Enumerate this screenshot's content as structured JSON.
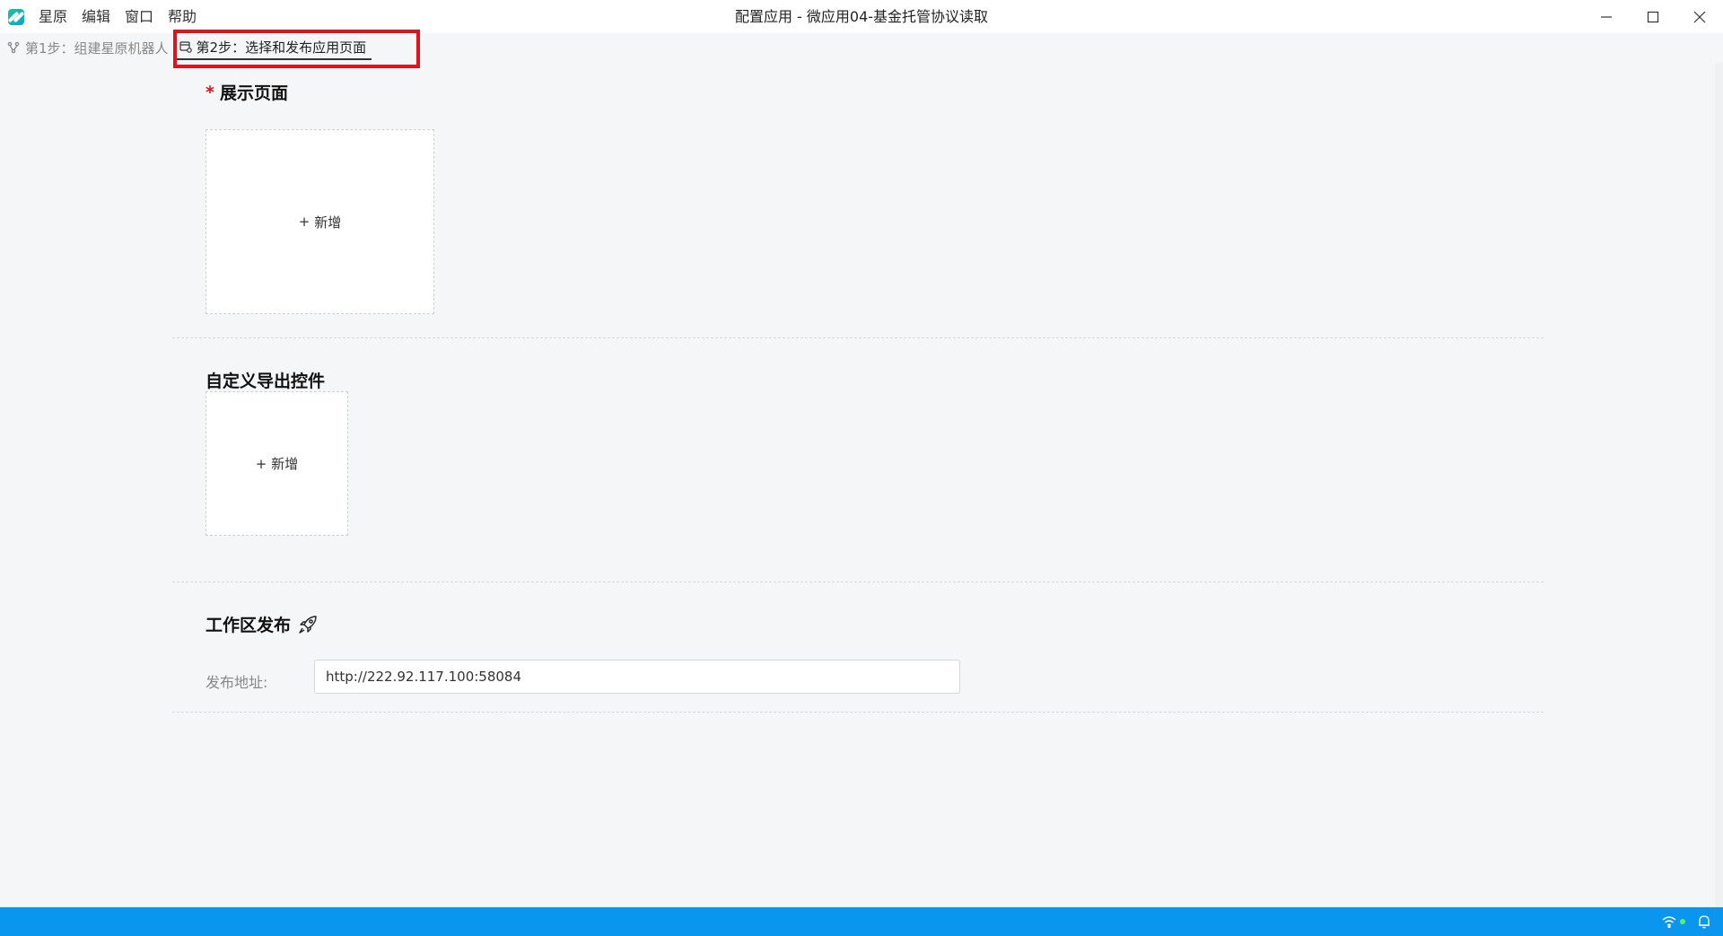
{
  "titlebar": {
    "menu": [
      "星原",
      "编辑",
      "窗口",
      "帮助"
    ],
    "title": "配置应用 - 微应用04-基金托管协议读取"
  },
  "steps": {
    "step1": "第1步：组建星原机器人",
    "step2": "第2步：选择和发布应用页面"
  },
  "display_section": {
    "required_mark": "*",
    "title": "展示页面",
    "add_label": "新增"
  },
  "export_section": {
    "title": "自定义导出控件",
    "add_label": "新增"
  },
  "publish_section": {
    "title": "工作区发布",
    "address_label": "发布地址:",
    "address_value": "http://222.92.117.100:58084"
  },
  "icons": {
    "logo": "app-logo-icon",
    "step1": "branch-icon",
    "step2": "page-settings-icon",
    "rocket": "rocket-icon",
    "wifi": "wifi-icon",
    "bell": "bell-icon"
  },
  "colors": {
    "accent_statusbar": "#0a96ef",
    "highlight": "#e0121b",
    "required": "#e0121b"
  }
}
